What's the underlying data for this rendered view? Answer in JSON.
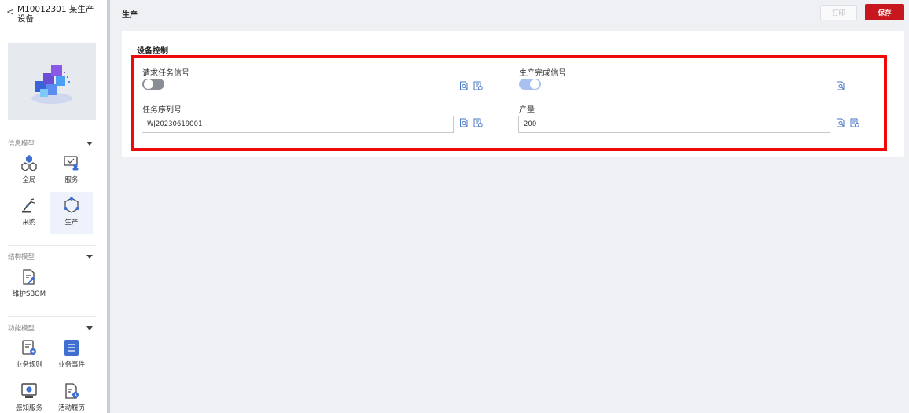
{
  "device": {
    "back_glyph": "<",
    "title": "M10012301 某生产设备"
  },
  "sidebar": {
    "sections": [
      {
        "label": "信息模型",
        "items": [
          {
            "label": "全局",
            "icon": "hexagon-cluster-icon"
          },
          {
            "label": "服务",
            "icon": "service-monitor-icon"
          },
          {
            "label": "采购",
            "icon": "robot-arm-icon"
          },
          {
            "label": "生产",
            "icon": "production-hexagon-icon",
            "active": true
          }
        ]
      },
      {
        "label": "结构模型",
        "items": [
          {
            "label": "维护SBOM",
            "icon": "document-tool-icon"
          }
        ]
      },
      {
        "label": "功能模型",
        "items": [
          {
            "label": "业务规则",
            "icon": "rules-document-icon"
          },
          {
            "label": "业务事件",
            "icon": "event-list-icon"
          },
          {
            "label": "感知服务",
            "icon": "sensing-monitor-icon"
          },
          {
            "label": "活动履历",
            "icon": "activity-document-icon"
          }
        ]
      }
    ]
  },
  "header": {
    "title": "生产",
    "print_label": "打印",
    "save_label": "保存"
  },
  "card": {
    "title": "设备控制",
    "fields": {
      "request_signal": {
        "label": "请求任务信号",
        "value": false
      },
      "done_signal": {
        "label": "生产完成信号",
        "value": true
      },
      "serial": {
        "label": "任务序列号",
        "value": "WJ20230619001"
      },
      "output": {
        "label": "产量",
        "value": "200"
      }
    }
  },
  "colors": {
    "accent": "#c8161e",
    "highlight": "#ee0a0a",
    "icon_blue": "#4a78c9"
  }
}
